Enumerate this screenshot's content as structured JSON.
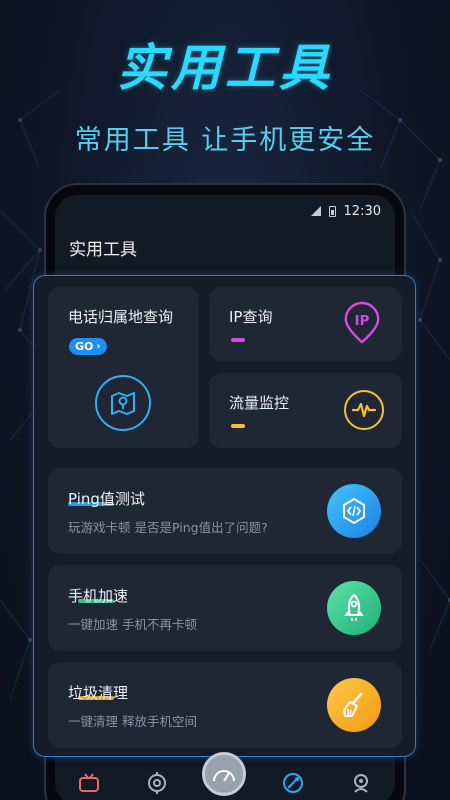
{
  "promo": {
    "title": "实用工具",
    "subtitle": "常用工具 让手机更安全"
  },
  "status_bar": {
    "time": "12:30"
  },
  "app": {
    "title": "实用工具"
  },
  "tools": {
    "phone_lookup": {
      "title": "电话归属地查询",
      "badge": "GO",
      "icon": "map-pin-icon"
    },
    "ip_query": {
      "title": "IP查询",
      "icon_text": "IP",
      "accent": "#d54bdb"
    },
    "traffic_monitor": {
      "title": "流量监控",
      "icon": "waveform-icon",
      "accent": "#f1c232"
    },
    "ping_test": {
      "title": "Ping值测试",
      "desc": "玩游戏卡顿 是否是Ping值出了问题?",
      "icon": "code-hexagon-icon",
      "accent": "#2fa6f6"
    },
    "phone_boost": {
      "title": "手机加速",
      "desc": "一键加速 手机不再卡顿",
      "icon": "rocket-icon",
      "accent": "#36d393"
    },
    "junk_clean": {
      "title": "垃圾清理",
      "desc": "一键清理 释放手机空间",
      "icon": "brush-icon",
      "accent": "#f5b021"
    }
  },
  "tabbar": {
    "items": [
      {
        "icon": "tv-icon"
      },
      {
        "icon": "target-icon"
      },
      {
        "icon": "speedometer-icon"
      },
      {
        "icon": "tools-icon"
      },
      {
        "icon": "robot-icon"
      }
    ]
  }
}
